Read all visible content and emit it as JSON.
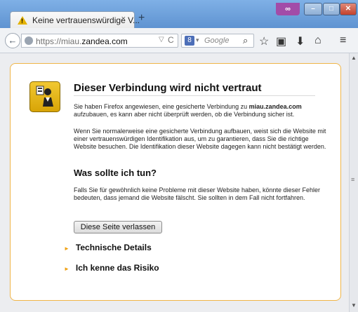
{
  "window": {
    "tab_title": "Keine vertrauenswürdige V...",
    "tab_close": "×",
    "new_tab": "+",
    "ext_label": "∞",
    "min": "–",
    "max": "□",
    "close": "✕"
  },
  "navbar": {
    "back": "←",
    "url_prefix": "https://miau.",
    "url_domain": "zandea.com",
    "dropdown": "▽",
    "reload": "C",
    "search_engine": "8",
    "search_dd": "▾",
    "search_placeholder": "Google",
    "search_icon": "⌕",
    "bookmark_icon": "☆",
    "library_icon": "▣",
    "download_icon": "⬇",
    "home_icon": "⌂",
    "menu_icon": "≡"
  },
  "page": {
    "title": "Dieser Verbindung wird nicht vertraut",
    "p1_a": "Sie haben Firefox angewiesen, eine gesicherte Verbindung zu ",
    "p1_domain": "miau.zandea.com",
    "p1_b": " aufzubauen, es kann aber nicht überprüft werden, ob die Verbindung sicher ist.",
    "p2": "Wenn Sie normalerweise eine gesicherte Verbindung aufbauen, weist sich die Website mit einer vertrauenswürdigen Identifikation aus, um zu garantieren, dass Sie die richtige Website besuchen. Die Identifikation dieser Website dagegen kann nicht bestätigt werden.",
    "h2": "Was sollte ich tun?",
    "p3": "Falls Sie für gewöhnlich keine Probleme mit dieser Website haben, könnte dieser Fehler bedeuten, dass jemand die Website fälscht. Sie sollten in dem Fall nicht fortfahren.",
    "leave_button": "Diese Seite verlassen",
    "tech_details": "Technische Details",
    "risk": "Ich kenne das Risiko",
    "triangle": "►"
  },
  "scrollbar": {
    "up": "▲",
    "grip": "≡",
    "down": "▼"
  }
}
